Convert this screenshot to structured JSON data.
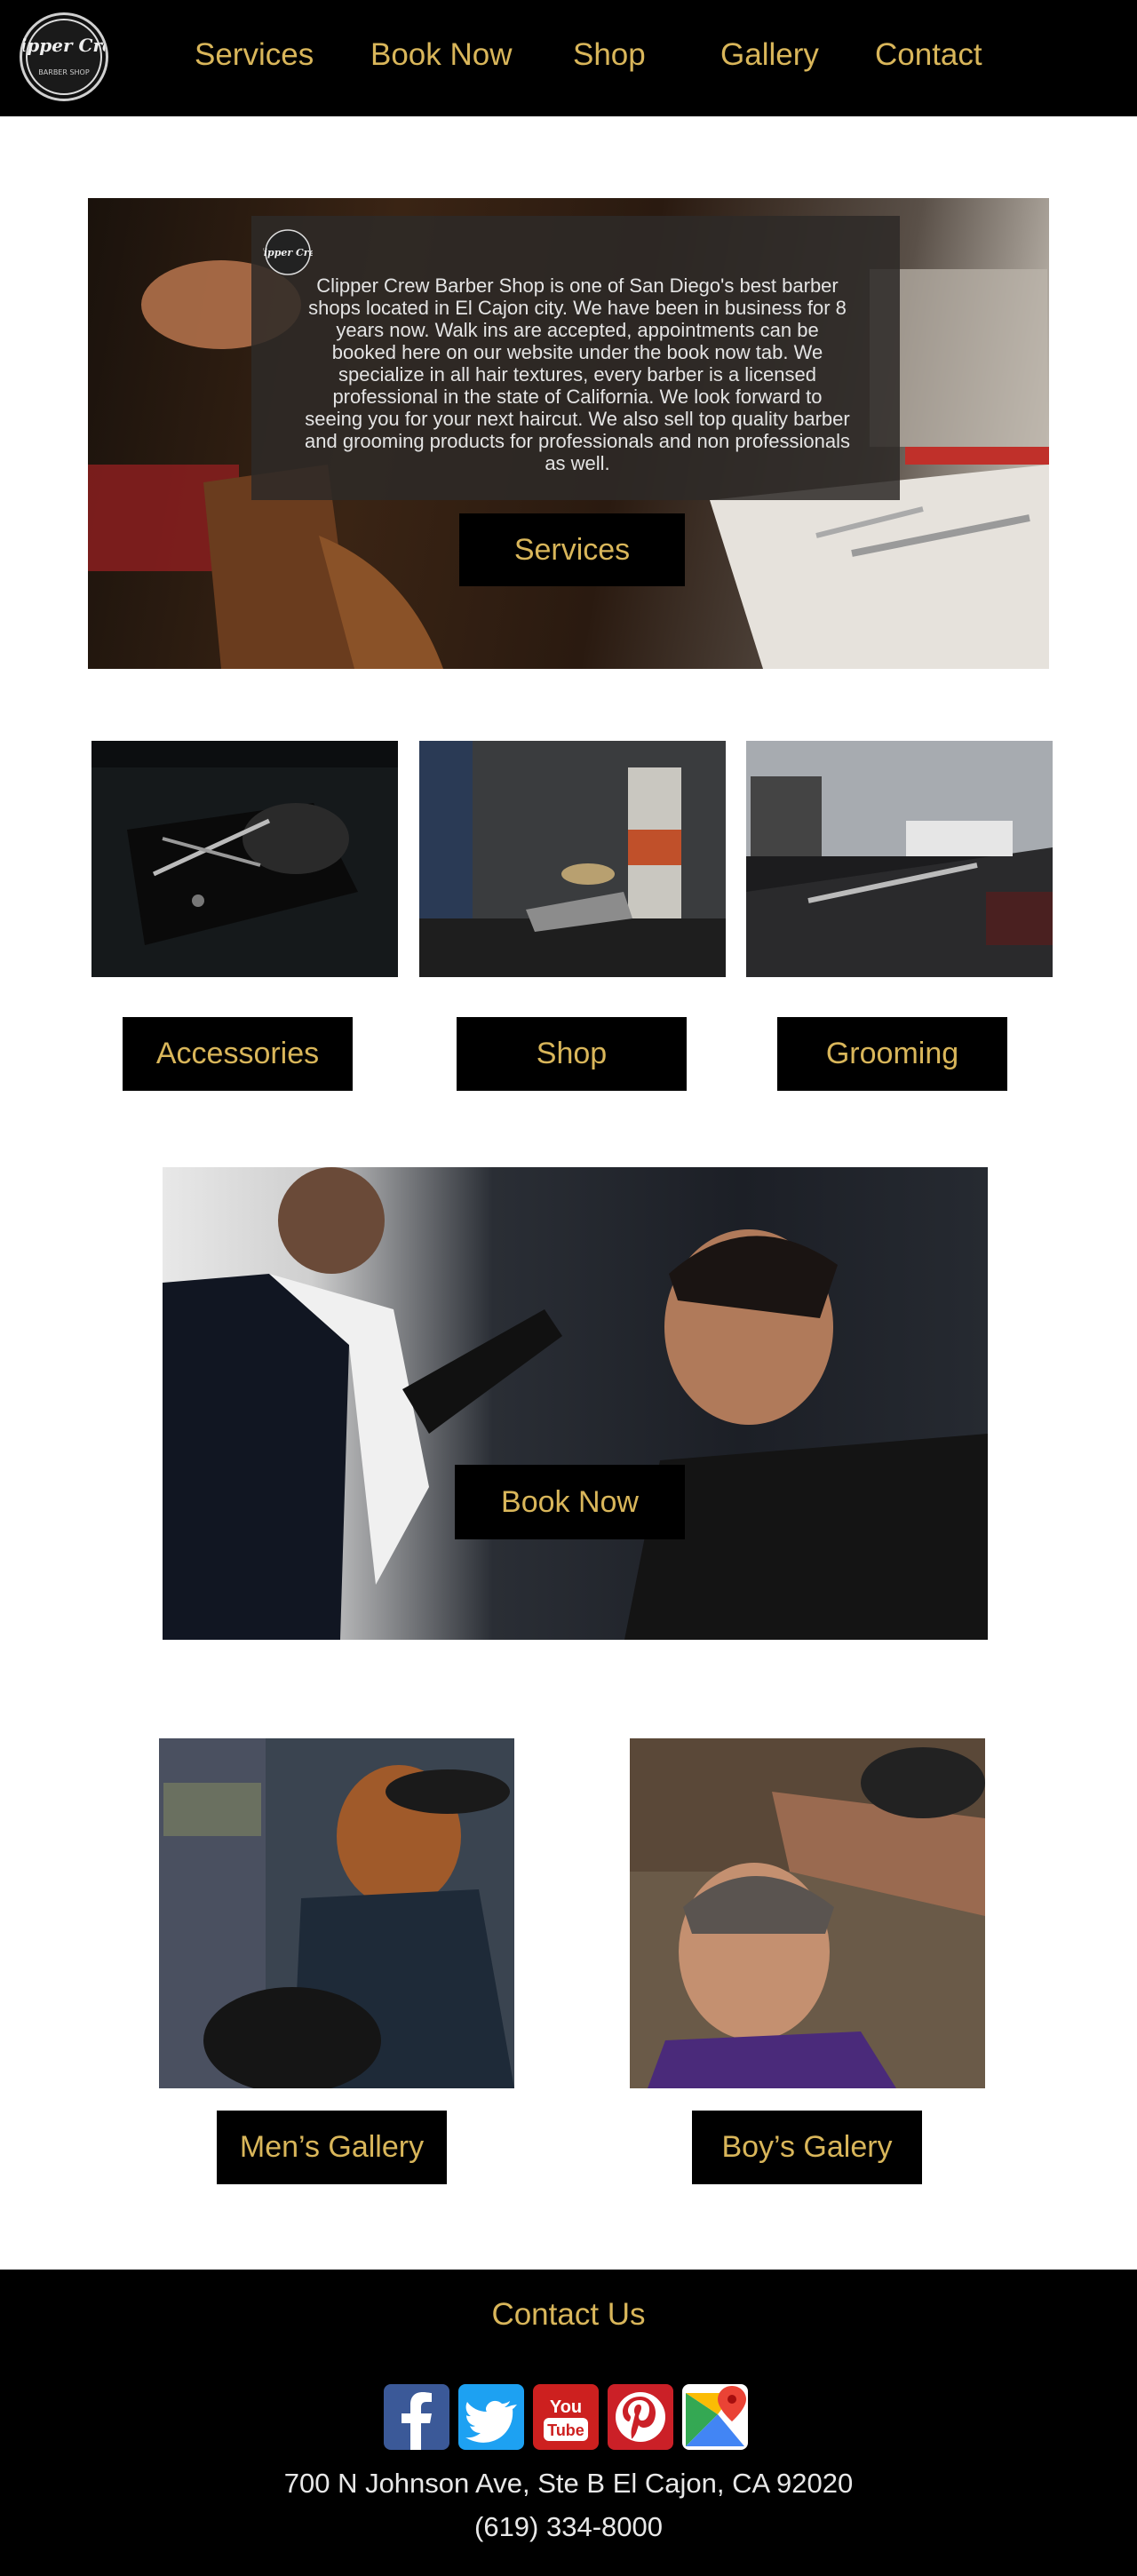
{
  "header": {
    "logo_text": "Clipper Crew",
    "logo_subtext": "BARBER SHOP",
    "nav": [
      "Services",
      "Book Now",
      "Shop",
      "Gallery",
      "Contact"
    ]
  },
  "hero": {
    "logo_text": "Clipper Crew",
    "description": "Clipper Crew Barber Shop is one of San Diego's best barber shops located in El Cajon city. We have been in business for 8 years now. Walk ins are accepted, appointments can be booked here on our website under the book now tab. We specialize in all hair textures, every barber is a licensed professional in the state of California. We look forward to seeing you for your next haircut. We also sell top quality barber and grooming products for professionals and non professionals as well.",
    "button": "Services"
  },
  "categories": [
    {
      "label": "Accessories"
    },
    {
      "label": "Shop"
    },
    {
      "label": "Grooming"
    }
  ],
  "book": {
    "button": "Book Now"
  },
  "gallery": {
    "mens": "Men’s Gallery",
    "boys": "Boy’s Galery"
  },
  "footer": {
    "title": "Contact Us",
    "social": [
      "facebook-icon",
      "twitter-icon",
      "youtube-icon",
      "pinterest-icon",
      "google-maps-icon"
    ],
    "youtube_text": "You Tube",
    "address": "700 N Johnson Ave, Ste B El Cajon, CA 92020",
    "phone": "(619) 334-8000"
  },
  "colors": {
    "accent": "#d9b65a",
    "background": "#000000",
    "facebook": "#3b5998",
    "twitter": "#1da1f2",
    "youtube": "#cd201f",
    "pinterest": "#cb2027"
  }
}
